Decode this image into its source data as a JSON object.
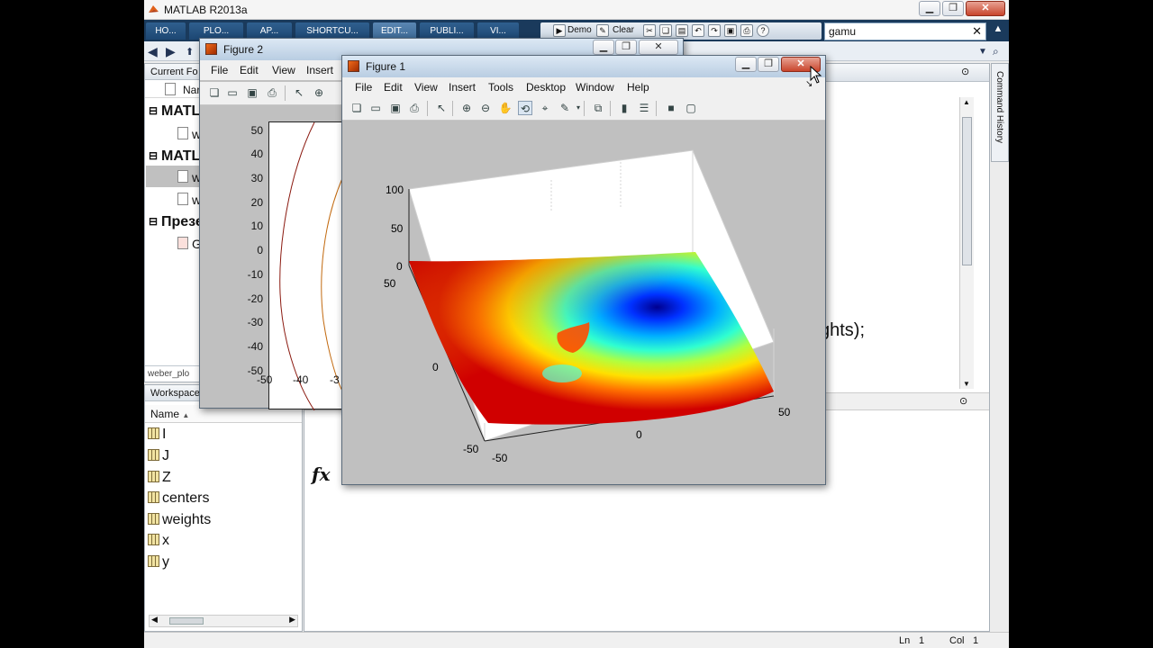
{
  "window": {
    "title": "MATLAB R2013a"
  },
  "ribbon": {
    "tabs": [
      "HO...",
      "PLO...",
      "AP...",
      "SHORTCU...",
      "EDIT...",
      "PUBLI...",
      "VI..."
    ],
    "quick": {
      "demo": "Demo",
      "clear": "Clear"
    },
    "search_value": "gamu"
  },
  "current_folder": {
    "title": "Current Fo",
    "column": "Nar",
    "rows": [
      {
        "label": "MATL",
        "type": "folder"
      },
      {
        "label": "w",
        "type": "file"
      },
      {
        "label": "MATL",
        "type": "folder"
      },
      {
        "label": "w",
        "type": "file",
        "selected": true
      },
      {
        "label": "w",
        "type": "file"
      },
      {
        "label": "Презе",
        "type": "folder"
      },
      {
        "label": "G",
        "type": "file"
      }
    ],
    "status": "weber_plo"
  },
  "workspace": {
    "title": "Workspace",
    "column": "Name",
    "variables": [
      "I",
      "J",
      "Z",
      "centers",
      "weights",
      "x",
      "y"
    ]
  },
  "command_window": {
    "partial_text": "ghts);",
    "fx_symbol": "fx"
  },
  "command_history": {
    "label": "Command History"
  },
  "statusbar": {
    "ln_label": "Ln",
    "ln_value": "1",
    "col_label": "Col",
    "col_value": "1"
  },
  "figure2": {
    "title": "Figure 2",
    "menu": [
      "File",
      "Edit",
      "View",
      "Insert"
    ],
    "y_ticks": [
      "50",
      "40",
      "30",
      "20",
      "10",
      "0",
      "-10",
      "-20",
      "-30",
      "-40",
      "-50"
    ],
    "x_ticks": [
      "-50",
      "-40",
      "-3"
    ]
  },
  "figure1": {
    "title": "Figure 1",
    "menu": [
      "File",
      "Edit",
      "View",
      "Insert",
      "Tools",
      "Desktop",
      "Window",
      "Help"
    ],
    "z_ticks": [
      "100",
      "50",
      "0"
    ],
    "axis_ticks": {
      "left_y": "50",
      "left_zero": "0",
      "left_neg": "-50",
      "front_neg": "-50",
      "front_zero": "0",
      "right_pos": "50"
    }
  },
  "chart_data": {
    "type": "surface",
    "colormap": "jet",
    "x_range": [
      -50,
      50
    ],
    "y_range": [
      -50,
      50
    ],
    "z_range": [
      0,
      100
    ],
    "z_ticks": [
      0,
      50,
      100
    ],
    "grid": true
  }
}
